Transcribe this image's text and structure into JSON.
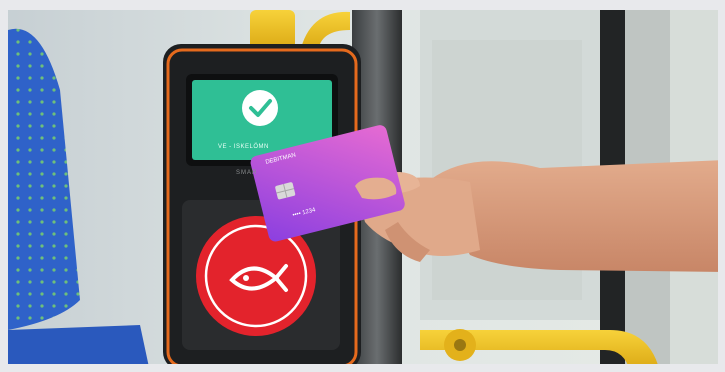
{
  "screen": {
    "status_text": "VE - ISKELÖMN",
    "bg_color": "#2fbf95",
    "check_icon": "checkmark-icon"
  },
  "reader": {
    "brand": "SMAR",
    "logo_icon": "fish-logo-icon",
    "logo_color": "#e3232c",
    "accent_color": "#e56a1d"
  },
  "card": {
    "brand": "DEBITMAN",
    "number": "•••• 1234",
    "chip_icon": "chip-icon"
  },
  "colors": {
    "handrail": "#f2c21a",
    "seat": "#2f62c9",
    "card_from": "#8b3fe0",
    "card_to": "#e76bd2"
  }
}
